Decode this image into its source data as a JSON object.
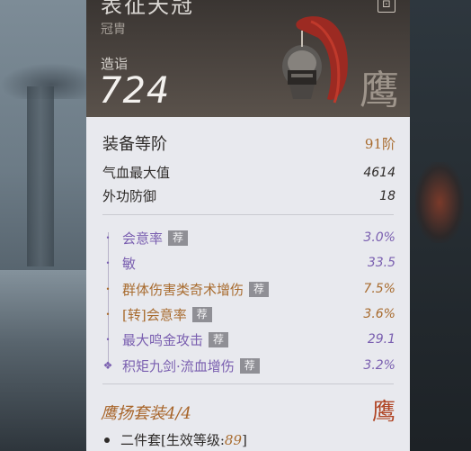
{
  "item": {
    "name": "表征天冠",
    "type": "冠胄",
    "forge_label": "造诣",
    "forge_value": "724",
    "brand_mark": "鹰",
    "lock_icon": "lock-icon"
  },
  "tier": {
    "label": "装备等阶",
    "value": "91阶"
  },
  "base_stats": [
    {
      "label": "气血最大值",
      "value": "4614"
    },
    {
      "label": "外功防御",
      "value": "18"
    }
  ],
  "affixes": [
    {
      "name": "会意率",
      "tag": "荐",
      "value": "3.0%",
      "color": "#7a5fb0",
      "dot": "•"
    },
    {
      "name": "敏",
      "tag": "",
      "value": "33.5",
      "color": "#7a5fb0",
      "dot": "•"
    },
    {
      "name": "群体伤害类奇术增伤",
      "tag": "荐",
      "value": "7.5%",
      "color": "#a86b2e",
      "dot": "•"
    },
    {
      "name": "[转]会意率",
      "tag": "荐",
      "value": "3.6%",
      "color": "#a86b2e",
      "dot": "•"
    },
    {
      "name": "最大鸣金攻击",
      "tag": "荐",
      "value": "29.1",
      "color": "#7a5fb0",
      "dot": "•"
    },
    {
      "name": "积矩九剑·流血增伤",
      "tag": "荐",
      "value": "3.2%",
      "color": "#7a5fb0",
      "dot": "❖"
    }
  ],
  "set": {
    "title": "鹰扬套装4/4",
    "mark": "鹰",
    "line_prefix": "二件套[生效等级:",
    "line_level": "89",
    "line_suffix": "]"
  }
}
